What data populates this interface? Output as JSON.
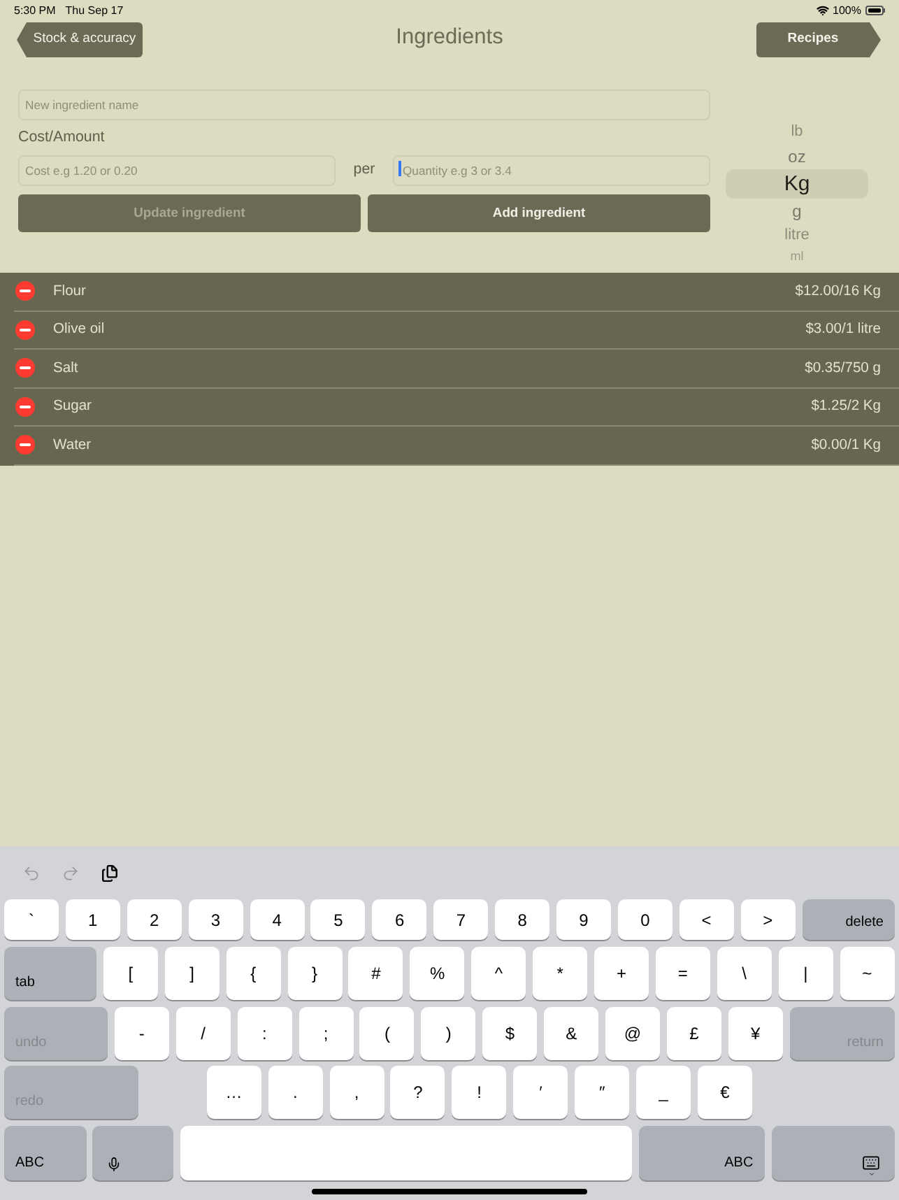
{
  "status_bar": {
    "time": "5:30 PM",
    "date": "Thu Sep 17",
    "battery": "100%"
  },
  "nav": {
    "back_button": "Stock & accuracy",
    "title": "Ingredients",
    "forward_button": "Recipes"
  },
  "form": {
    "name_field": {
      "placeholder": "New ingredient name"
    },
    "cost_label": "Cost/Amount",
    "cost_field": {
      "placeholder": "Cost e.g 1.20 or 0.20"
    },
    "per_label": "per",
    "quantity_field": {
      "placeholder": "Quantity e.g 3 or 3.4",
      "focused": true
    },
    "buttons": [
      {
        "label": "Update ingredient",
        "disabled": true
      },
      {
        "label": "Add ingredient",
        "disabled": false
      }
    ]
  },
  "unit_picker": [
    {
      "label": "lb",
      "selected": false
    },
    {
      "label": "oz",
      "selected": false
    },
    {
      "label": "Kg",
      "selected": true
    },
    {
      "label": "g",
      "selected": false
    },
    {
      "label": "litre",
      "selected": false
    },
    {
      "label": "ml",
      "selected": false
    }
  ],
  "ingredients": [
    {
      "name": "Flour",
      "cost": "$12.00/16 Kg"
    },
    {
      "name": "Olive oil",
      "cost": "$3.00/1 litre"
    },
    {
      "name": "Salt",
      "cost": "$0.35/750 g"
    },
    {
      "name": "Sugar",
      "cost": "$1.25/2 Kg"
    },
    {
      "name": "Water",
      "cost": "$0.00/1 Kg"
    }
  ],
  "keyboard": {
    "toolbar": [
      {
        "kind": "undo",
        "disabled": true
      },
      {
        "kind": "redo",
        "disabled": true
      },
      {
        "kind": "paste",
        "disabled": false
      }
    ],
    "rows": [
      {
        "keys": [
          {
            "kind": "char",
            "label": "`",
            "disabled": false
          },
          {
            "kind": "char",
            "label": "1",
            "disabled": false
          },
          {
            "kind": "char",
            "label": "2",
            "disabled": false
          },
          {
            "kind": "char",
            "label": "3",
            "disabled": false
          },
          {
            "kind": "char",
            "label": "4",
            "disabled": false
          },
          {
            "kind": "char",
            "label": "5",
            "disabled": false
          },
          {
            "kind": "char",
            "label": "6",
            "disabled": false
          },
          {
            "kind": "char",
            "label": "7",
            "disabled": false
          },
          {
            "kind": "char",
            "label": "8",
            "disabled": false
          },
          {
            "kind": "char",
            "label": "9",
            "disabled": false
          },
          {
            "kind": "char",
            "label": "0",
            "disabled": false
          },
          {
            "kind": "char",
            "label": "<",
            "disabled": false
          },
          {
            "kind": "char",
            "label": ">",
            "disabled": false
          },
          {
            "kind": "action_right",
            "label": "delete",
            "disabled": false
          }
        ]
      },
      {
        "keys": [
          {
            "kind": "action_left",
            "label": "tab",
            "disabled": false
          },
          {
            "kind": "char",
            "label": "[",
            "disabled": false
          },
          {
            "kind": "char",
            "label": "]",
            "disabled": false
          },
          {
            "kind": "char",
            "label": "{",
            "disabled": false
          },
          {
            "kind": "char",
            "label": "}",
            "disabled": false
          },
          {
            "kind": "char",
            "label": "#",
            "disabled": false
          },
          {
            "kind": "char",
            "label": "%",
            "disabled": false
          },
          {
            "kind": "char",
            "label": "^",
            "disabled": false
          },
          {
            "kind": "char",
            "label": "*",
            "disabled": false
          },
          {
            "kind": "char",
            "label": "+",
            "disabled": false
          },
          {
            "kind": "char",
            "label": "=",
            "disabled": false
          },
          {
            "kind": "char",
            "label": "\\",
            "disabled": false
          },
          {
            "kind": "char",
            "label": "|",
            "disabled": false
          },
          {
            "kind": "char",
            "label": "~",
            "disabled": false
          }
        ]
      },
      {
        "keys": [
          {
            "kind": "action_left",
            "label": "undo",
            "disabled": true
          },
          {
            "kind": "char",
            "label": "-",
            "disabled": false
          },
          {
            "kind": "char",
            "label": "/",
            "disabled": false
          },
          {
            "kind": "char",
            "label": ":",
            "disabled": false
          },
          {
            "kind": "char",
            "label": ";",
            "disabled": false
          },
          {
            "kind": "char",
            "label": "(",
            "disabled": false
          },
          {
            "kind": "char",
            "label": ")",
            "disabled": false
          },
          {
            "kind": "char",
            "label": "$",
            "disabled": false
          },
          {
            "kind": "char",
            "label": "&",
            "disabled": false
          },
          {
            "kind": "char",
            "label": "@",
            "disabled": false
          },
          {
            "kind": "char",
            "label": "£",
            "disabled": false
          },
          {
            "kind": "char",
            "label": "¥",
            "disabled": false
          },
          {
            "kind": "action_right",
            "label": "return",
            "disabled": true
          }
        ]
      },
      {
        "keys": [
          {
            "kind": "action_left",
            "label": "redo",
            "disabled": true
          },
          {
            "kind": "char",
            "label": "…",
            "disabled": false
          },
          {
            "kind": "char",
            "label": ".",
            "disabled": false
          },
          {
            "kind": "char",
            "label": ",",
            "disabled": false
          },
          {
            "kind": "char",
            "label": "?",
            "disabled": false
          },
          {
            "kind": "char",
            "label": "!",
            "disabled": false
          },
          {
            "kind": "char",
            "label": "′",
            "disabled": false
          },
          {
            "kind": "char",
            "label": "″",
            "disabled": false
          },
          {
            "kind": "char",
            "label": "_",
            "disabled": false
          },
          {
            "kind": "char",
            "label": "€",
            "disabled": false
          }
        ]
      },
      {
        "keys": [
          {
            "kind": "action_left",
            "label": "ABC",
            "disabled": false
          },
          {
            "kind": "mic",
            "disabled": false
          },
          {
            "kind": "space",
            "disabled": false
          },
          {
            "kind": "action_right",
            "label": "ABC",
            "disabled": false
          },
          {
            "kind": "dismiss",
            "disabled": false
          }
        ]
      }
    ]
  }
}
